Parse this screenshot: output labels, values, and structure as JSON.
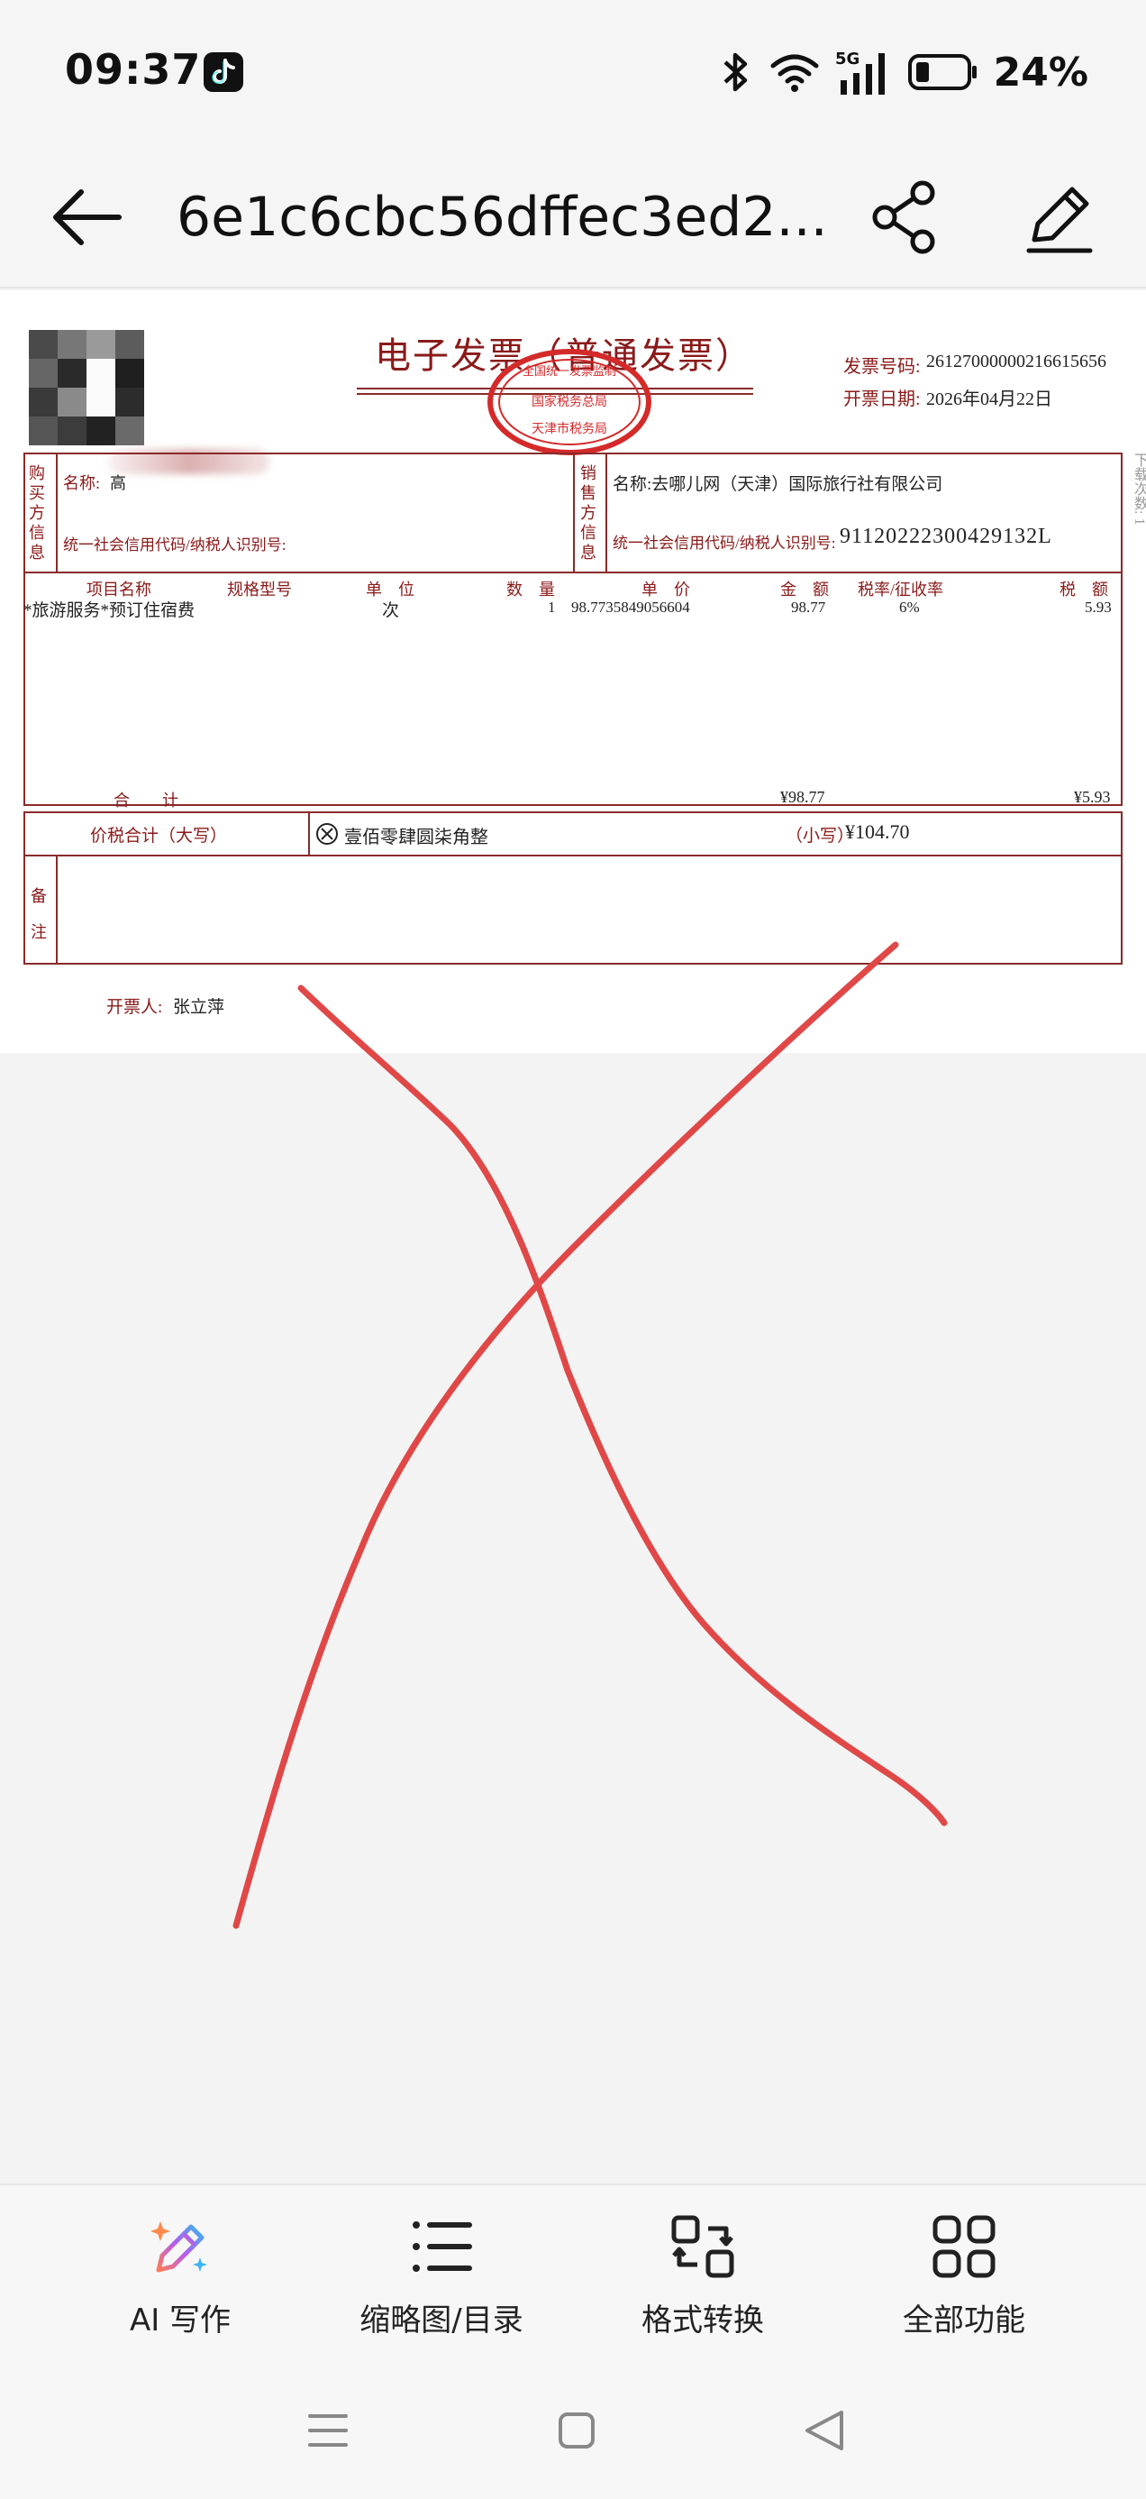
{
  "status_bar": {
    "time": "09:37",
    "battery_percent": "24%",
    "network": "5G",
    "icons": [
      "tiktok-icon",
      "bluetooth-icon",
      "wifi-icon",
      "signal-icon",
      "battery-icon"
    ]
  },
  "header": {
    "title": "6e1c6cbc56dffec3ed2...",
    "back_icon": "arrow-left-icon",
    "share_icon": "share-icon",
    "edit_icon": "pencil-icon"
  },
  "invoice": {
    "title": "电子发票（普通发票）",
    "number_label": "发票号码:",
    "number_value": "26127000000216615656",
    "date_label": "开票日期:",
    "date_value": "2026年04月22日",
    "stamp_top": "国家税务总局",
    "stamp_bottom": "天津市税务局",
    "stamp_fragment": "全国统一发票监制",
    "side_note": "下载次数: 1",
    "buyer_label": "购买方信息",
    "buyer_name_label": "名称:",
    "buyer_name_value": "高",
    "buyer_tax_label": "统一社会信用代码/纳税人识别号:",
    "seller_label": "销售方信息",
    "seller_name": "名称:去哪儿网（天津）国际旅行社有限公司",
    "seller_tax_label": "统一社会信用代码/纳税人识别号:",
    "seller_tax_value": "91120222300429132L",
    "columns": [
      "项目名称",
      "规格型号",
      "单　位",
      "数　量",
      "单　价",
      "金　额",
      "税率/征收率",
      "税　额"
    ],
    "item": {
      "name": "*旅游服务*预订住宿费",
      "unit": "次",
      "qty": "1",
      "price": "98.7735849056604",
      "amount": "98.77",
      "rate": "6%",
      "tax": "5.93"
    },
    "total_label": "合　　计",
    "total_amount": "¥98.77",
    "total_tax": "¥5.93",
    "grand_label": "价税合计（大写）",
    "grand_words": "壹佰零肆圆柒角整",
    "grand_small_label": "（小写）",
    "grand_small_value": "¥104.70",
    "remarks_label": "备注",
    "issuer_label": "开票人:",
    "issuer_value": "张立萍"
  },
  "toolbar": {
    "items": [
      {
        "label": "AI 写作",
        "icon": "ai-pen-icon"
      },
      {
        "label": "缩略图/目录",
        "icon": "list-icon"
      },
      {
        "label": "格式转换",
        "icon": "convert-icon"
      },
      {
        "label": "全部功能",
        "icon": "grid-icon"
      }
    ]
  },
  "navbar": {
    "icons": [
      "menu-icon",
      "home-icon",
      "back-triangle-icon"
    ]
  },
  "colors": {
    "invoice_red": "#8a1a1a",
    "x_mark": "#e04848",
    "background": "#f3f3f3"
  }
}
